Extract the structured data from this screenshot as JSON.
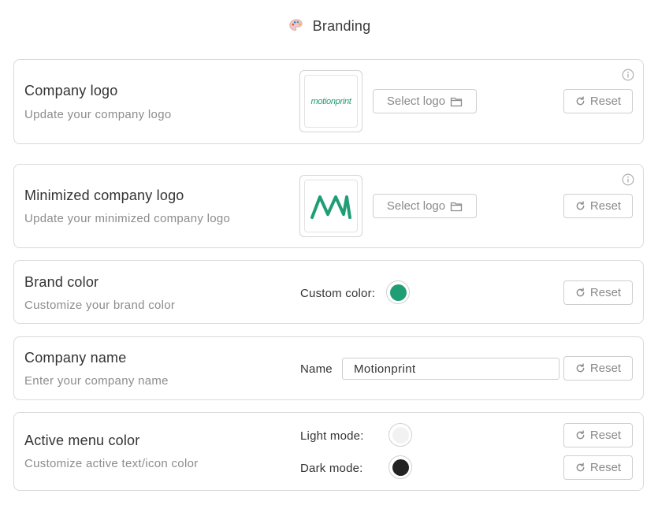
{
  "header": {
    "title": "Branding",
    "icon": "palette-icon"
  },
  "company_logo": {
    "title": "Company logo",
    "subtitle": "Update your company logo",
    "select_label": "Select logo",
    "reset_label": "Reset",
    "logo_text": "motionprint"
  },
  "minimized_logo": {
    "title": "Minimized company logo",
    "subtitle": "Update your minimized company logo",
    "select_label": "Select logo",
    "reset_label": "Reset"
  },
  "brand_color": {
    "title": "Brand color",
    "subtitle": "Customize your brand color",
    "custom_label": "Custom color:",
    "color": "#1f9e76",
    "reset_label": "Reset"
  },
  "company_name": {
    "title": "Company name",
    "subtitle": "Enter your company name",
    "name_label": "Name",
    "value": "Motionprint",
    "reset_label": "Reset"
  },
  "active_menu_color": {
    "title": "Active menu color",
    "subtitle": "Customize active text/icon color",
    "light_label": "Light mode:",
    "light_color": "#f2f2f2",
    "dark_label": "Dark mode:",
    "dark_color": "#222222",
    "reset_light_label": "Reset",
    "reset_dark_label": "Reset"
  },
  "colors": {
    "brand": "#1f9e76",
    "border": "#d9d9d9",
    "muted": "#8c8c8c"
  }
}
